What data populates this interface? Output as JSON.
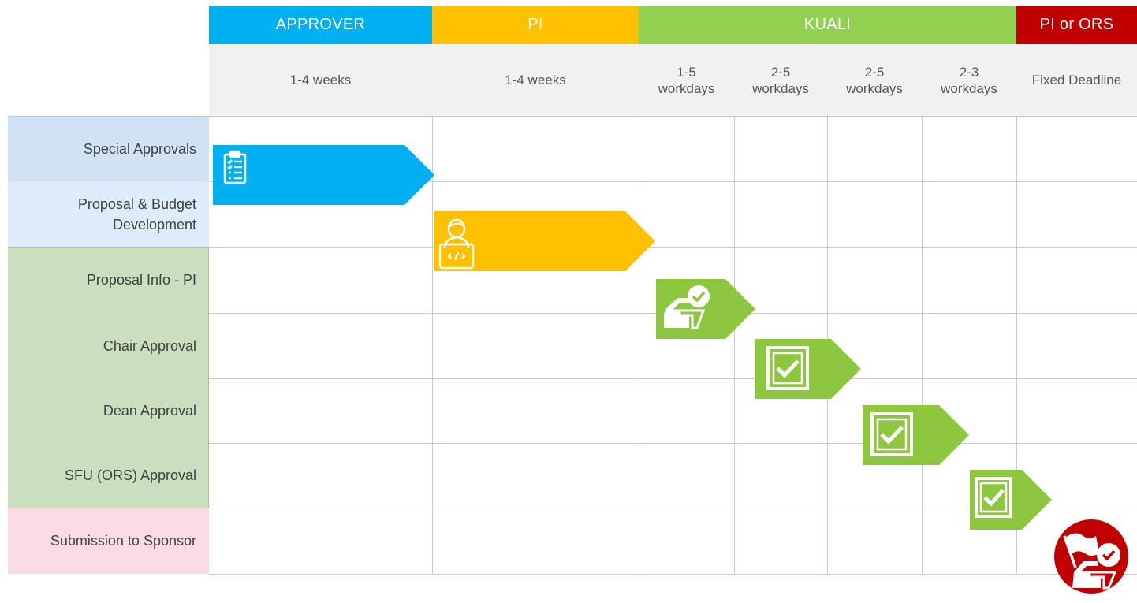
{
  "phases": [
    {
      "label": "APPROVER",
      "color": "#00b0f0"
    },
    {
      "label": "PI",
      "color": "#ffc000"
    },
    {
      "label": "KUALI",
      "color": "#92d050"
    },
    {
      "label": "PI or ORS",
      "color": "#c00000"
    }
  ],
  "durations": [
    "1-4 weeks",
    "1-4 weeks",
    "1-5\nworkdays",
    "2-5\nworkdays",
    "2-5\nworkdays",
    "2-3\nworkdays",
    "Fixed Deadline"
  ],
  "rows": [
    {
      "label": "Special Approvals",
      "group": "approver"
    },
    {
      "label": "Proposal & Budget\nDevelopment",
      "group": "pi"
    },
    {
      "label": "Proposal Info - PI",
      "group": "kuali"
    },
    {
      "label": "Chair Approval",
      "group": "kuali"
    },
    {
      "label": "Dean Approval",
      "group": "kuali"
    },
    {
      "label": "SFU (ORS) Approval",
      "group": "kuali"
    },
    {
      "label": "Submission to Sponsor",
      "group": "submission"
    }
  ],
  "row_colors": {
    "approver": "#cfe3f5",
    "pi": "#deebfb",
    "kuali": "#cadfc0",
    "submission": "#fadbe4"
  },
  "steps": [
    {
      "icon": "clipboard-checklist-icon",
      "color": "#00b0f0"
    },
    {
      "icon": "person-laptop-icon",
      "color": "#ffc000"
    },
    {
      "icon": "inbox-check-icon",
      "color": "#8dc63f"
    },
    {
      "icon": "checkbox-icon",
      "color": "#8dc63f"
    },
    {
      "icon": "checkbox-icon",
      "color": "#8dc63f"
    },
    {
      "icon": "checkbox-icon",
      "color": "#8dc63f"
    },
    {
      "icon": "flag-inbox-check-icon",
      "color": "#c00000"
    }
  ]
}
